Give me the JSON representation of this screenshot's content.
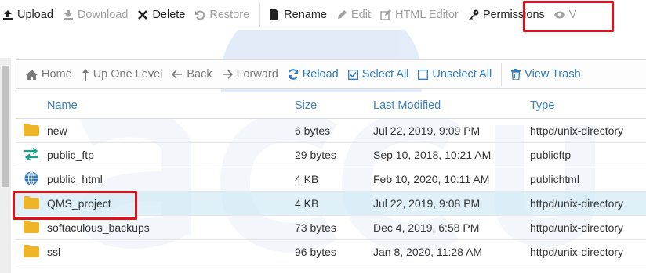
{
  "toolbar": {
    "upload": "Upload",
    "download": "Download",
    "delete": "Delete",
    "restore": "Restore",
    "rename": "Rename",
    "edit": "Edit",
    "html_editor": "HTML Editor",
    "permissions": "Permissions",
    "view": "V"
  },
  "nav": {
    "home": "Home",
    "up_one_level": "Up One Level",
    "back": "Back",
    "forward": "Forward",
    "reload": "Reload",
    "select_all": "Select All",
    "unselect_all": "Unselect All",
    "view_trash": "View Trash"
  },
  "table": {
    "headers": {
      "name": "Name",
      "size": "Size",
      "modified": "Last Modified",
      "type": "Type"
    },
    "rows": [
      {
        "icon": "folder-icon",
        "name": "new",
        "size": "6 bytes",
        "modified": "Jul 22, 2019, 9:09 PM",
        "type": "httpd/unix-directory",
        "selected": false
      },
      {
        "icon": "ftp-arrows-icon",
        "name": "public_ftp",
        "size": "29 bytes",
        "modified": "Sep 10, 2018, 10:21 AM",
        "type": "publicftp",
        "selected": false
      },
      {
        "icon": "globe-icon",
        "name": "public_html",
        "size": "4 KB",
        "modified": "Feb 10, 2020, 10:11 AM",
        "type": "publichtml",
        "selected": false
      },
      {
        "icon": "folder-icon",
        "name": "QMS_project",
        "size": "4 KB",
        "modified": "Jul 22, 2019, 9:08 PM",
        "type": "httpd/unix-directory",
        "selected": true
      },
      {
        "icon": "folder-icon",
        "name": "softaculous_backups",
        "size": "73 bytes",
        "modified": "Dec 4, 2019, 6:58 PM",
        "type": "httpd/unix-directory",
        "selected": false
      },
      {
        "icon": "folder-icon",
        "name": "ssl",
        "size": "96 bytes",
        "modified": "Jan 8, 2020, 11:28 AM",
        "type": "httpd/unix-directory",
        "selected": false
      }
    ]
  },
  "colors": {
    "accent": "#2f7ac0",
    "header_text": "#3a82c4",
    "highlight_box": "#e0111b",
    "folder": "#f0b429",
    "selected_row": "#d9edf7"
  }
}
